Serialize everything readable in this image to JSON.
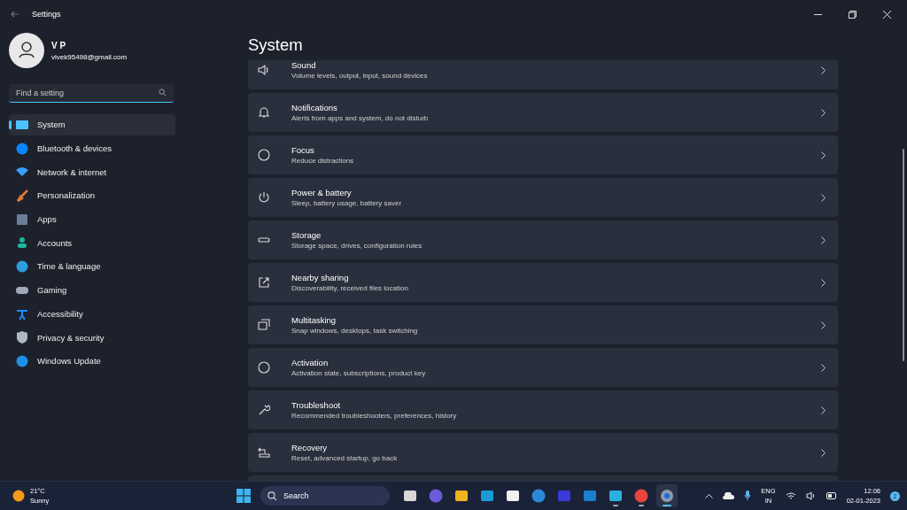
{
  "window": {
    "title": "Settings"
  },
  "profile": {
    "name": "V P",
    "email": "vivek95498@gmail.com"
  },
  "search": {
    "placeholder": "Find a setting"
  },
  "nav": [
    {
      "label": "System",
      "selected": true
    },
    {
      "label": "Bluetooth & devices",
      "selected": false
    },
    {
      "label": "Network & internet",
      "selected": false
    },
    {
      "label": "Personalization",
      "selected": false
    },
    {
      "label": "Apps",
      "selected": false
    },
    {
      "label": "Accounts",
      "selected": false
    },
    {
      "label": "Time & language",
      "selected": false
    },
    {
      "label": "Gaming",
      "selected": false
    },
    {
      "label": "Accessibility",
      "selected": false
    },
    {
      "label": "Privacy & security",
      "selected": false
    },
    {
      "label": "Windows Update",
      "selected": false
    }
  ],
  "page_title": "System",
  "settings": [
    {
      "title": "Sound",
      "subtitle": "Volume levels, output, input, sound devices"
    },
    {
      "title": "Notifications",
      "subtitle": "Alerts from apps and system, do not disturb"
    },
    {
      "title": "Focus",
      "subtitle": "Reduce distractions"
    },
    {
      "title": "Power & battery",
      "subtitle": "Sleep, battery usage, battery saver"
    },
    {
      "title": "Storage",
      "subtitle": "Storage space, drives, configuration rules"
    },
    {
      "title": "Nearby sharing",
      "subtitle": "Discoverability, received files location"
    },
    {
      "title": "Multitasking",
      "subtitle": "Snap windows, desktops, task switching"
    },
    {
      "title": "Activation",
      "subtitle": "Activation state, subscriptions, product key"
    },
    {
      "title": "Troubleshoot",
      "subtitle": "Recommended troubleshooters, preferences, history"
    },
    {
      "title": "Recovery",
      "subtitle": "Reset, advanced startup, go back"
    }
  ],
  "taskbar": {
    "weather": {
      "temp": "21°C",
      "condition": "Sunny"
    },
    "search": "Search",
    "apps": [
      {
        "running": false,
        "selected": false
      },
      {
        "running": false,
        "selected": false
      },
      {
        "running": false,
        "selected": false
      },
      {
        "running": false,
        "selected": false
      },
      {
        "running": false,
        "selected": false
      },
      {
        "running": false,
        "selected": false
      },
      {
        "running": false,
        "selected": false
      },
      {
        "running": false,
        "selected": false
      },
      {
        "running": true,
        "selected": false
      },
      {
        "running": true,
        "selected": false
      },
      {
        "running": true,
        "selected": true
      }
    ],
    "language": "ENG",
    "region": "IN",
    "time": "12:06",
    "date": "02-01-2023",
    "notifications": "2"
  }
}
